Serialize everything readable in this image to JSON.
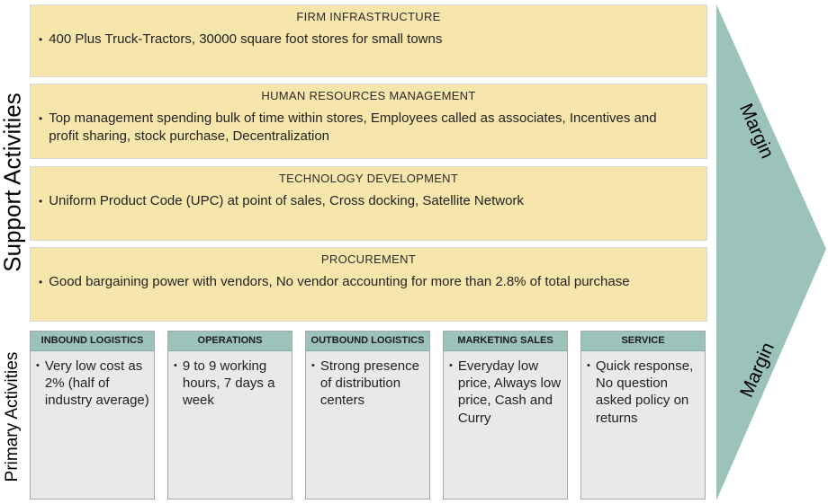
{
  "colors": {
    "teal": "#9BC3BB",
    "band_yellow": "#F7E6AB",
    "column_gray": "#E9E9E9",
    "band_border": "#D8D8D8",
    "column_border": "#A9A9A9"
  },
  "glyphs": {
    "bullet": "•"
  },
  "side_labels": {
    "support": "Support Activities",
    "primary": "Primary Activities"
  },
  "support_activities": [
    {
      "title": "FIRM INFRASTRUCTURE",
      "bullet": "400 Plus Truck-Tractors, 30000 square foot stores for small towns"
    },
    {
      "title": "HUMAN RESOURCES MANAGEMENT",
      "bullet": "Top management spending bulk of time within stores, Employees called as associates, Incentives and profit sharing, stock purchase, Decentralization"
    },
    {
      "title": "TECHNOLOGY DEVELOPMENT",
      "bullet": "Uniform Product Code (UPC) at point of sales, Cross docking, Satellite Network"
    },
    {
      "title": "PROCUREMENT",
      "bullet": "Good bargaining power with vendors, No vendor accounting for more than 2.8% of total purchase"
    }
  ],
  "primary_activities": [
    {
      "title": "INBOUND LOGISTICS",
      "bullet": "Very low cost as 2% (half of industry average)"
    },
    {
      "title": "OPERATIONS",
      "bullet": "9 to 9 working hours, 7 days a week"
    },
    {
      "title": "OUTBOUND LOGISTICS",
      "bullet": "Strong presence of distribution centers"
    },
    {
      "title": "MARKETING SALES",
      "bullet": "Everyday low price, Always low price, Cash and Curry"
    },
    {
      "title": "SERVICE",
      "bullet": "Quick response, No question asked policy on returns"
    }
  ],
  "margin": {
    "top_label": "Margin",
    "bottom_label": "Margin"
  }
}
